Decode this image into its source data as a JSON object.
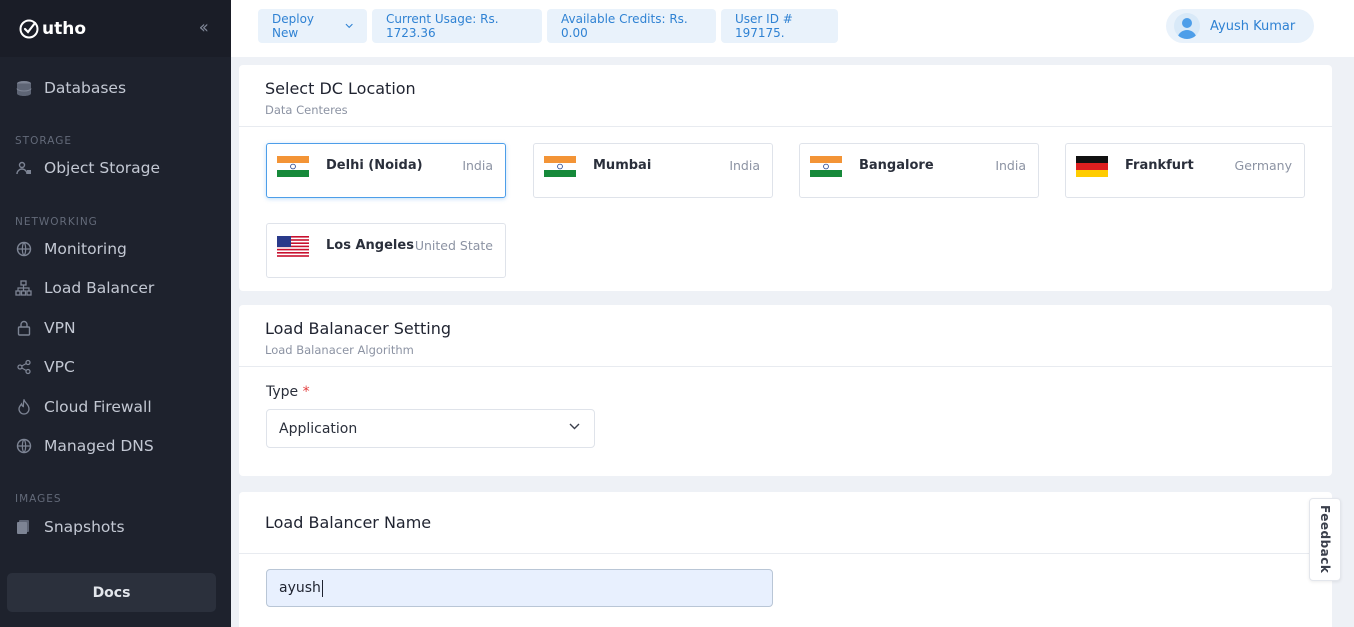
{
  "brand": {
    "name": "utho"
  },
  "sidebar": {
    "items": [
      {
        "label": "Databases",
        "icon": "database-icon"
      },
      {
        "section": "STORAGE"
      },
      {
        "label": "Object Storage",
        "icon": "object-storage-icon"
      },
      {
        "section": "NETWORKING"
      },
      {
        "label": "Monitoring",
        "icon": "globe-icon"
      },
      {
        "label": "Load Balancer",
        "icon": "sitemap-icon"
      },
      {
        "label": "VPN",
        "icon": "lock-icon"
      },
      {
        "label": "VPC",
        "icon": "share-icon"
      },
      {
        "label": "Cloud Firewall",
        "icon": "fire-icon"
      },
      {
        "label": "Managed DNS",
        "icon": "globe-icon"
      },
      {
        "section": "IMAGES"
      },
      {
        "label": "Snapshots",
        "icon": "snapshot-icon"
      }
    ],
    "docs_label": "Docs"
  },
  "topbar": {
    "deploy_label": "Deploy New",
    "usage_label": "Current Usage: Rs. 1723.36",
    "credits_label": "Available Credits: Rs. 0.00",
    "userid_label": "User ID # 197175.",
    "user_name": "Ayush Kumar"
  },
  "dc": {
    "title": "Select DC Location",
    "subtitle": "Data Centeres",
    "locations": [
      {
        "city": "Delhi (Noida)",
        "country": "India",
        "flag": "india-flag-icon",
        "selected": true
      },
      {
        "city": "Mumbai",
        "country": "India",
        "flag": "india-flag-icon",
        "selected": false
      },
      {
        "city": "Bangalore",
        "country": "India",
        "flag": "india-flag-icon",
        "selected": false
      },
      {
        "city": "Frankfurt",
        "country": "Germany",
        "flag": "germany-flag-icon",
        "selected": false
      },
      {
        "city": "Los Angeles",
        "country": "United State",
        "flag": "usa-flag-icon",
        "selected": false
      }
    ]
  },
  "lb_setting": {
    "title": "Load Balanacer Setting",
    "subtitle": "Load Balanacer Algorithm",
    "type_label": "Type",
    "required_mark": "*",
    "type_value": "Application"
  },
  "lb_name": {
    "title": "Load Balancer Name",
    "value": "ayush"
  },
  "feedback_label": "Feedback",
  "colors": {
    "accent": "#2f82d3",
    "sidebar_bg": "#1e222d",
    "selected_border": "#4d9ee9"
  }
}
